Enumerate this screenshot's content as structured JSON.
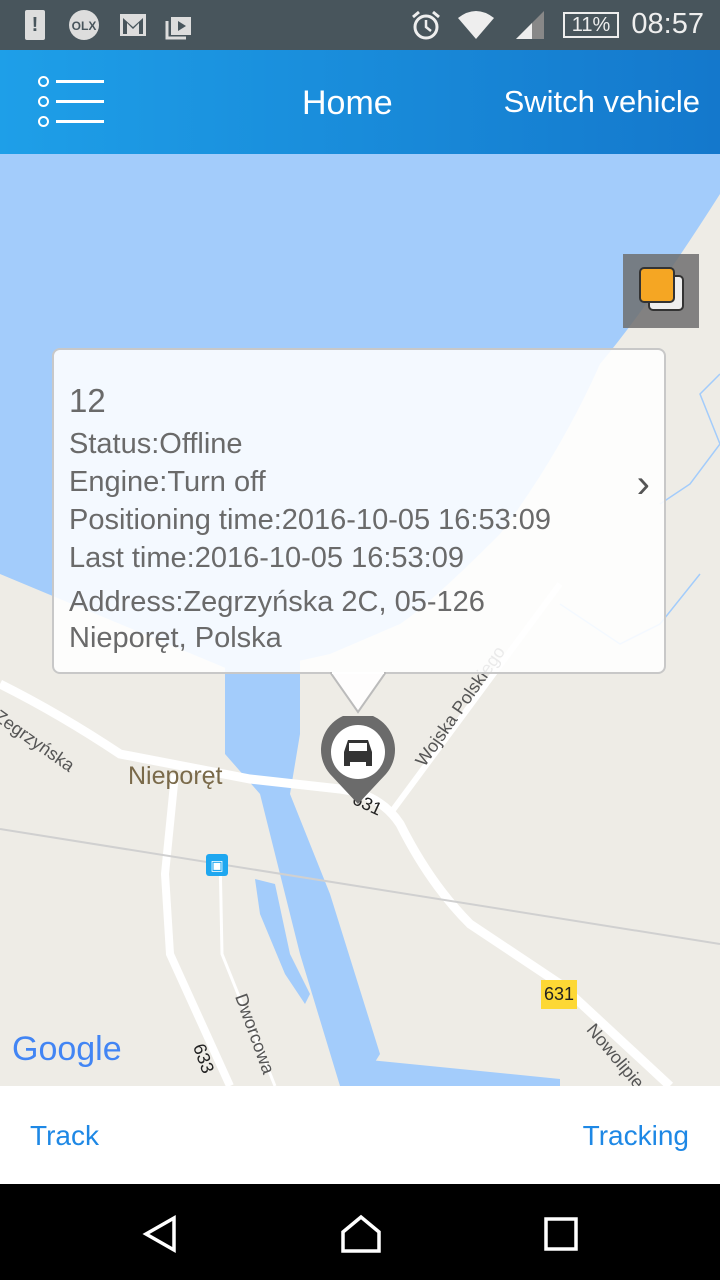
{
  "status_bar": {
    "battery": "11%",
    "time": "08:57",
    "icons": [
      "alert-icon",
      "olx-icon",
      "gmail-icon",
      "play-store-icon",
      "alarm-icon",
      "wifi-icon",
      "signal-icon",
      "battery-icon"
    ],
    "olx_text": "OLX"
  },
  "header": {
    "title": "Home",
    "switch_vehicle": "Switch vehicle",
    "menu_icon": "list-menu-icon"
  },
  "popup": {
    "name": "12",
    "status": "Status:Offline",
    "engine": "Engine:Turn off",
    "positioning_time": "Positioning time:2016-10-05 16:53:09",
    "last_time": "Last time:2016-10-05 16:53:09",
    "address_line1": "Address:Zegrzyńska 2C, 05-126",
    "address_line2": "Nieporęt, Polska"
  },
  "map": {
    "labels": {
      "town": "Nieporęt",
      "street1": "Zegrzyńska",
      "street2": "Wojska Polskiego",
      "street3": "Dworcowa",
      "street4": "Nowolipie",
      "road_631_a": "631",
      "road_631_b": "631",
      "road_633": "633"
    },
    "google": "Google",
    "water_color": "#a3ccfb",
    "land_color": "#eeece6"
  },
  "bottom": {
    "track": "Track",
    "tracking": "Tracking"
  },
  "colors": {
    "accent": "#1e88e5",
    "header_start": "#1e9fe8",
    "header_end": "#1478cc"
  }
}
